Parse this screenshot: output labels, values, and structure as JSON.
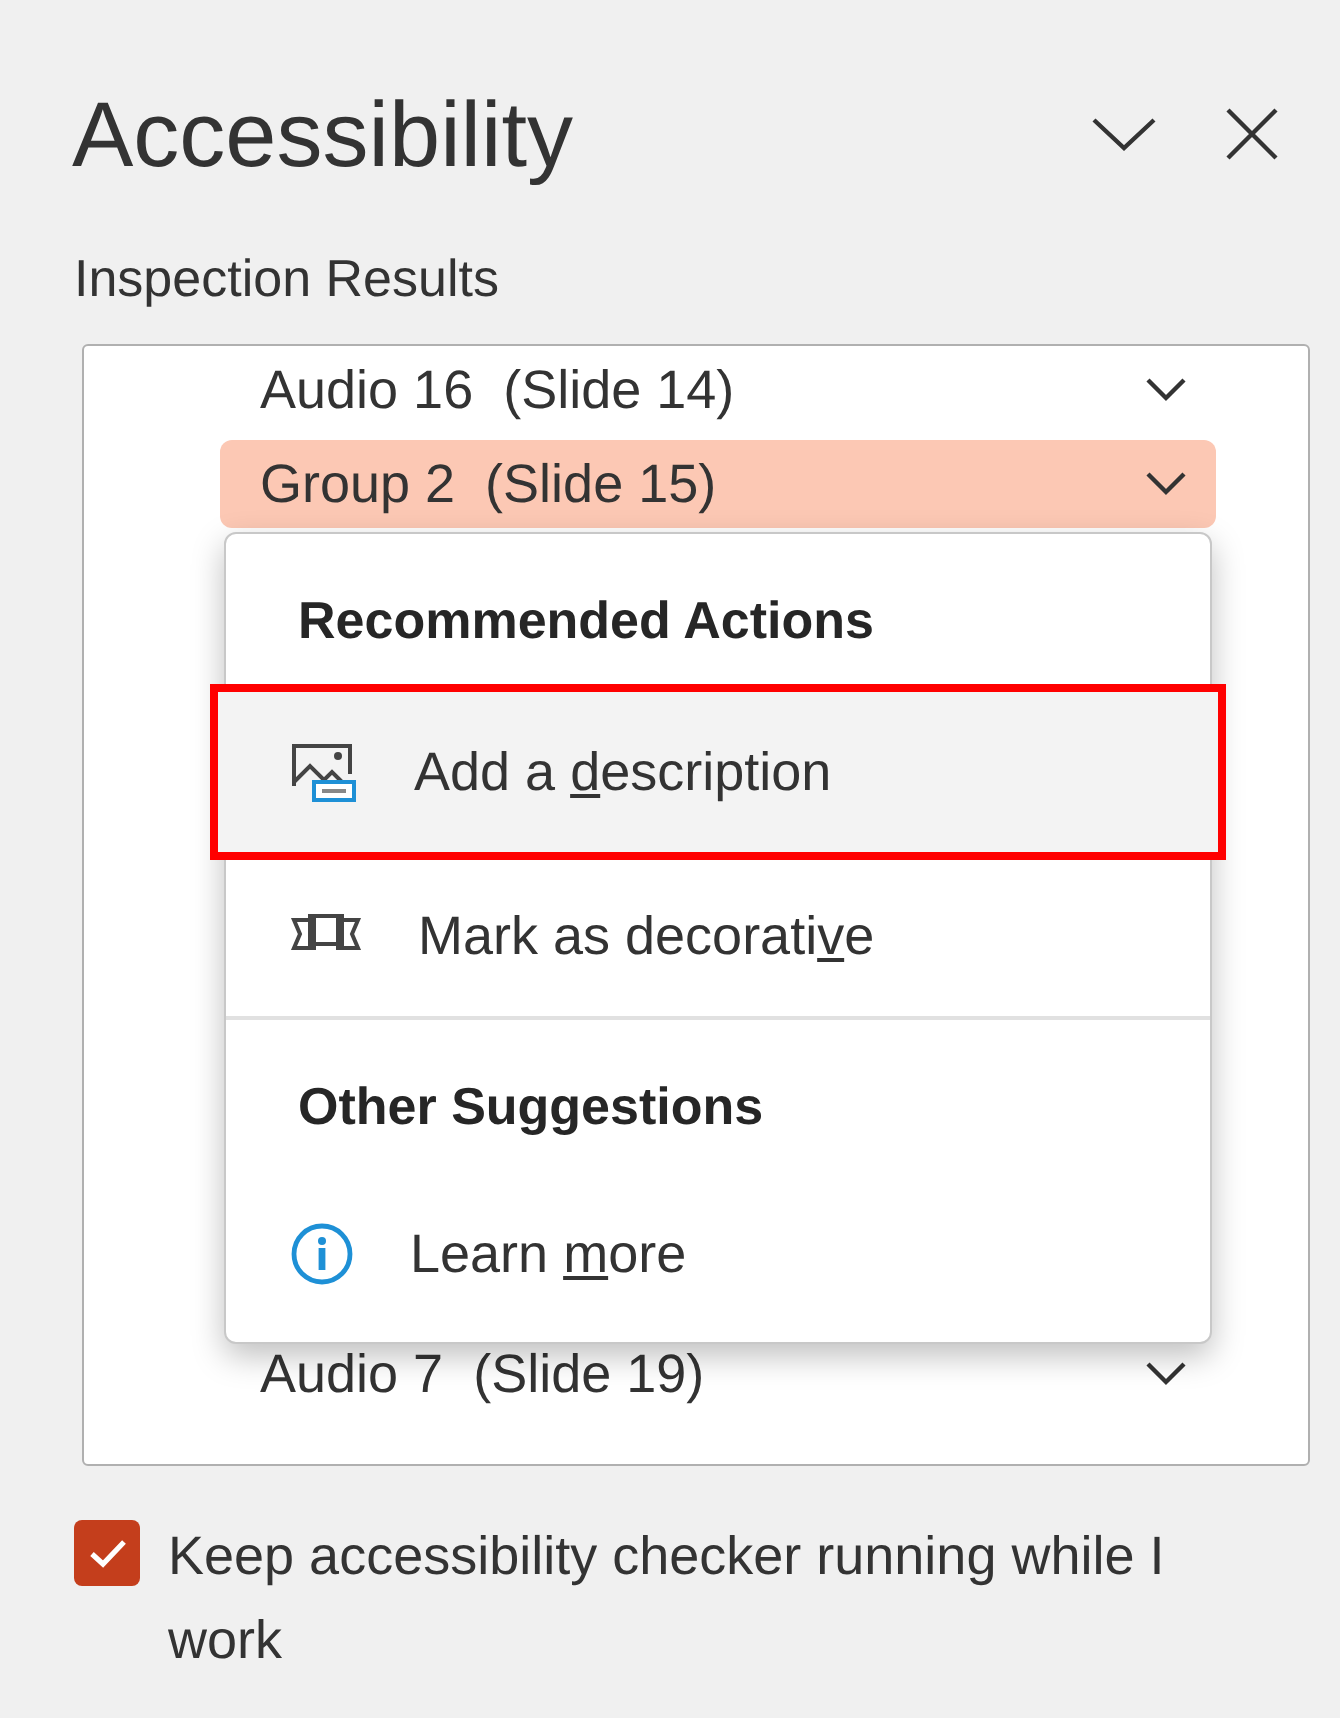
{
  "pane": {
    "title": "Accessibility"
  },
  "section_label": "Inspection Results",
  "results": [
    {
      "label": "Audio 16  (Slide 14)",
      "selected": false
    },
    {
      "label": "Group 2  (Slide 15)",
      "selected": true
    },
    {
      "label": "Audio 7  (Slide 19)",
      "selected": false
    }
  ],
  "popup": {
    "groups": [
      {
        "heading": "Recommended Actions",
        "items": [
          {
            "kind": "description",
            "before": "Add a ",
            "key": "d",
            "after": "escription",
            "highlighted": true
          },
          {
            "kind": "decorative",
            "before": "Mark as decorati",
            "key": "v",
            "after": "e",
            "highlighted": false
          }
        ]
      },
      {
        "heading": "Other Suggestions",
        "items": [
          {
            "kind": "info",
            "before": "Learn ",
            "key": "m",
            "after": "ore",
            "highlighted": false
          }
        ]
      }
    ]
  },
  "keep_running": {
    "label": "Keep accessibility checker running while I work",
    "checked": true
  }
}
